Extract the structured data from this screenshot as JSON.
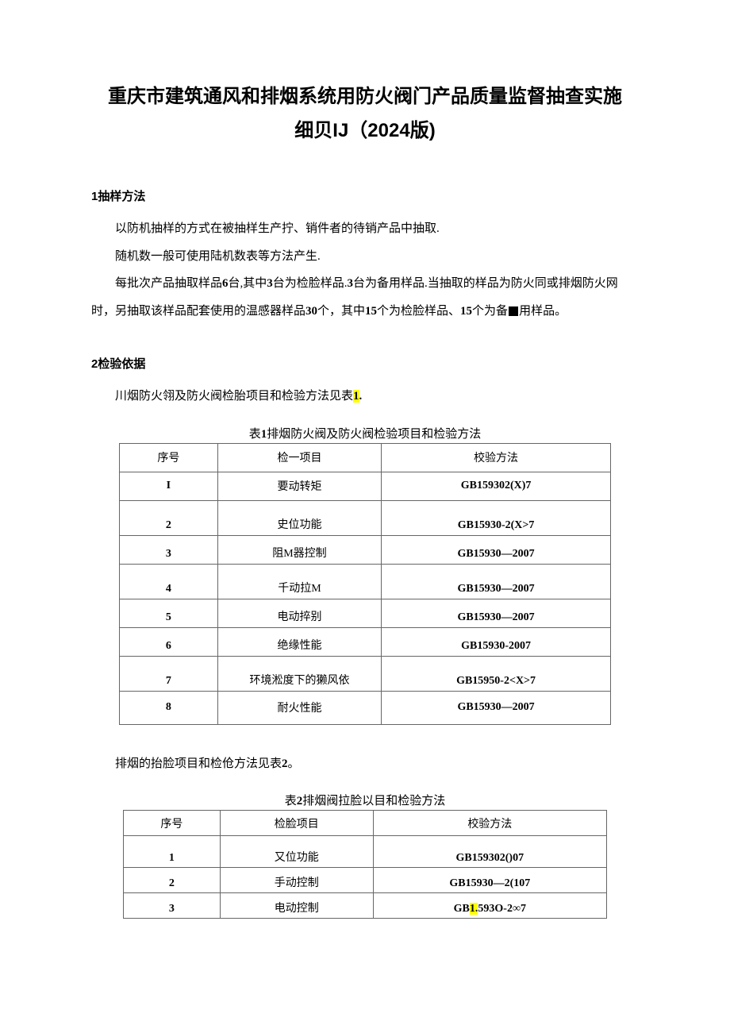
{
  "title_line1": "重庆市建筑通风和排烟系统用防火阀门产品质量监督抽查实施",
  "title_line2": "细贝IJ（2024版)",
  "section1": {
    "num": "1",
    "heading": "抽样方法",
    "p1": "以防机抽样的方式在被抽样生产拧、销件者的待销产品中抽取.",
    "p2": "随机数一般可使用陆机数表等方法产生.",
    "p3_prefix": "每批次产品抽取样品",
    "p3_6": "6",
    "p3_a": "台,其中",
    "p3_3a": "3",
    "p3_b": "台为检脸样品.",
    "p3_3b": "3",
    "p3_c": "台为备用样品.当抽取的样品为防火同或排烟防火网时，另抽取该样品配套使用的温感器样品",
    "p3_30": "30",
    "p3_d": "个，其中",
    "p3_15a": "15",
    "p3_e": "个为检脸样品、",
    "p3_15b": "15",
    "p3_f": "个为备",
    "p3_g": "用样品。"
  },
  "section2": {
    "num": "2",
    "heading": "检验依据",
    "p1_prefix": "川烟防火翎及防火阀检胎项目和检验方法见表",
    "p1_num": "1",
    "p1_suffix": "."
  },
  "table1": {
    "caption_prefix": "表",
    "caption_num": "1",
    "caption_text": "排烟防火阀及防火阀检验项目和检验方法",
    "headers": [
      "序号",
      "检一项目",
      "校验方法"
    ],
    "rows": [
      {
        "idx": "I",
        "item": "要动转矩",
        "method": "GB159302(X)7"
      },
      {
        "idx": "2",
        "item": "史位功能",
        "method": "GB15930-2(X>7"
      },
      {
        "idx": "3",
        "item": "阻M器控制",
        "method": "GB15930—2007"
      },
      {
        "idx": "4",
        "item": "千动拉M",
        "method": "GB15930—2007"
      },
      {
        "idx": "5",
        "item": "电动捽别",
        "method": "GB15930—2007"
      },
      {
        "idx": "6",
        "item": "绝缘性能",
        "method": "GB15930-2007"
      },
      {
        "idx": "7",
        "item": "环境淞度下的獭风依",
        "method": "GB15950-2<X>7"
      },
      {
        "idx": "8",
        "item": "耐火性能",
        "method": "GB15930—2007"
      }
    ]
  },
  "section2_p2_prefix": "排烟的抬脸项目和检伧方法见表",
  "section2_p2_num": "2",
  "section2_p2_suffix": "。",
  "table2": {
    "caption_prefix": "表",
    "caption_num": "2",
    "caption_text": "排烟阀拉脸以目和检验方法",
    "headers": [
      "序号",
      "检脸项目",
      "校验方法"
    ],
    "rows": [
      {
        "idx": "1",
        "item": "又位功能",
        "method_a": "GB159302()07",
        "method_hl": "",
        "method_b": ""
      },
      {
        "idx": "2",
        "item": "手动控制",
        "method_a": "GB15930—2(107",
        "method_hl": "",
        "method_b": ""
      },
      {
        "idx": "3",
        "item": "电动控制",
        "method_a": "GB",
        "method_hl": "1.",
        "method_b": "593O-2∞7"
      }
    ]
  }
}
